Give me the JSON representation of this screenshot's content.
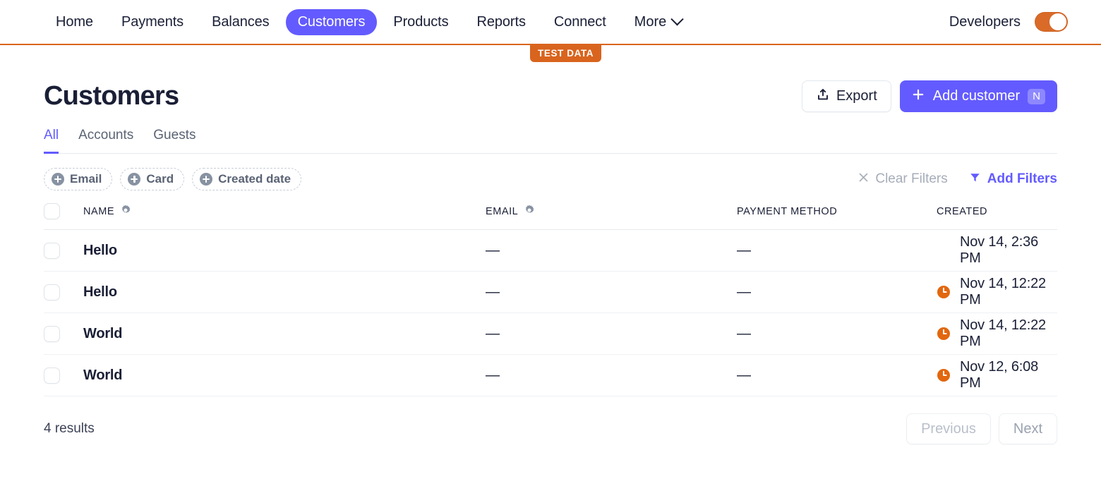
{
  "nav": {
    "items": [
      {
        "label": "Home",
        "active": false
      },
      {
        "label": "Payments",
        "active": false
      },
      {
        "label": "Balances",
        "active": false
      },
      {
        "label": "Customers",
        "active": true
      },
      {
        "label": "Products",
        "active": false
      },
      {
        "label": "Reports",
        "active": false
      },
      {
        "label": "Connect",
        "active": false
      }
    ],
    "more_label": "More",
    "developers_label": "Developers",
    "toggle_state": "on",
    "test_data_badge": "TEST DATA",
    "accent_color": "#635bff",
    "test_color": "#d9641e"
  },
  "header": {
    "title": "Customers",
    "export_label": "Export",
    "add_label": "Add customer",
    "add_shortcut": "N"
  },
  "tabs": [
    {
      "label": "All",
      "active": true
    },
    {
      "label": "Accounts",
      "active": false
    },
    {
      "label": "Guests",
      "active": false
    }
  ],
  "filters": {
    "chips": [
      "Email",
      "Card",
      "Created date"
    ],
    "clear_label": "Clear Filters",
    "add_label": "Add Filters"
  },
  "table": {
    "columns": [
      "NAME",
      "EMAIL",
      "PAYMENT METHOD",
      "CREATED"
    ],
    "rows": [
      {
        "name": "Hello",
        "email": "—",
        "payment_method": "—",
        "created": "Nov 14, 2:36 PM",
        "has_clock": false
      },
      {
        "name": "Hello",
        "email": "—",
        "payment_method": "—",
        "created": "Nov 14, 12:22 PM",
        "has_clock": true
      },
      {
        "name": "World",
        "email": "—",
        "payment_method": "—",
        "created": "Nov 14, 12:22 PM",
        "has_clock": true
      },
      {
        "name": "World",
        "email": "—",
        "payment_method": "—",
        "created": "Nov 12, 6:08 PM",
        "has_clock": true
      }
    ]
  },
  "footer": {
    "results_label": "4 results",
    "previous_label": "Previous",
    "next_label": "Next"
  }
}
